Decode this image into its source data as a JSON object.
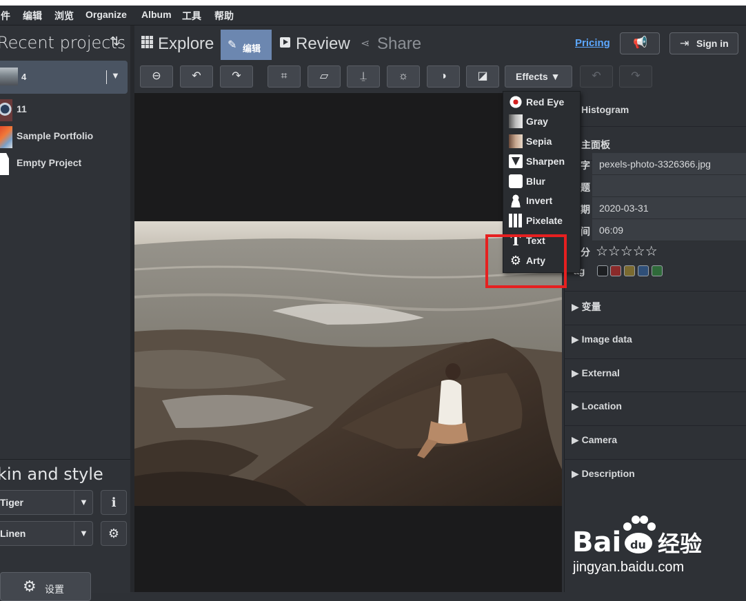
{
  "menubar": [
    "件",
    "编辑",
    "浏览",
    "Organize",
    "Album",
    "工具",
    "帮助"
  ],
  "left": {
    "title": "Recent projects",
    "projects": [
      {
        "label": "4",
        "selected": true
      },
      {
        "label": "11"
      },
      {
        "label": "Sample Portfolio"
      },
      {
        "label": "Empty Project"
      }
    ],
    "skin_title": "kin and style",
    "skin_value": "Tiger",
    "style_value": "Linen",
    "settings_label": "设置"
  },
  "tabs": {
    "explore": "Explore",
    "edit": "编辑",
    "review": "Review",
    "share": "Share"
  },
  "header": {
    "pricing": "Pricing",
    "signin": "Sign in"
  },
  "toolbar": {
    "effects": "Effects ▼"
  },
  "effects_menu": [
    {
      "label": "Red Eye",
      "icon": "red-eye-icon"
    },
    {
      "label": "Gray",
      "icon": "gray-icon"
    },
    {
      "label": "Sepia",
      "icon": "sepia-icon"
    },
    {
      "label": "Sharpen",
      "icon": "sharpen-icon"
    },
    {
      "label": "Blur",
      "icon": "blur-icon"
    },
    {
      "label": "Invert",
      "icon": "invert-icon"
    },
    {
      "label": "Pixelate",
      "icon": "pixelate-icon"
    },
    {
      "label": "Text",
      "icon": "text-icon"
    },
    {
      "label": "Arty",
      "icon": "arty-icon"
    }
  ],
  "right": {
    "histogram": "Histogram",
    "main_panel": "主面板",
    "fields": [
      {
        "key": "字",
        "value": "pexels-photo-3326366.jpg"
      },
      {
        "key": "题",
        "value": ""
      },
      {
        "key": "期",
        "value": "2020-03-31"
      },
      {
        "key": "间",
        "value": "06:09"
      }
    ],
    "rating_key": "分",
    "rating_stars": "☆☆☆☆☆",
    "tag_key": "ag",
    "tag_colors": [
      "#1d1f22",
      "#8a2a2a",
      "#7a6a30",
      "#2f4f78",
      "#2f6a3a"
    ],
    "sections": [
      "▶ 变量",
      "▶ Image data",
      "▶ External",
      "▶ Location",
      "▶ Camera",
      "▶ Description"
    ]
  },
  "watermark": {
    "text": "jingyan.baidu.com"
  },
  "colors": {
    "accent_tab": "#6c87b0",
    "link": "#5ca7ff",
    "highlight": "#e62020"
  }
}
